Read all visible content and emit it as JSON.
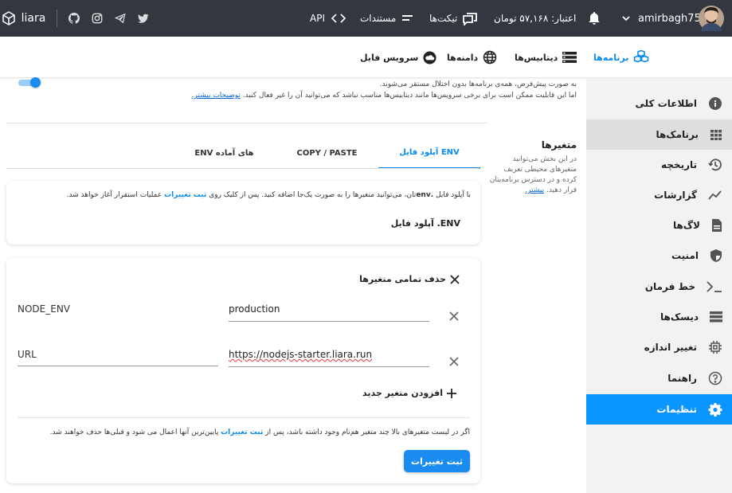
{
  "topbar": {
    "brand": "liara",
    "api": "API",
    "docs": "مستندات",
    "tickets": "تیکت‌ها",
    "credit": "اعتبار: ۵۷,۱۶۸ تومان",
    "username": "amirbagh75",
    "icons": [
      "cube-logo",
      "github",
      "instagram",
      "telegram",
      "twitter",
      "code",
      "docs-lines",
      "chat",
      "bell",
      "chevron-down",
      "avatar"
    ]
  },
  "secbar": {
    "apps": "برنامه‌ها",
    "databases": "دیتابیس‌ها",
    "domains": "دامنه‌ها",
    "file_service": "سرویس فایل"
  },
  "sidebar": {
    "items": [
      {
        "label": "اطلاعات کلی",
        "icon": "info-icon"
      },
      {
        "label": "برنامک‌ها",
        "icon": "grid-icon"
      },
      {
        "label": "تاریخچه",
        "icon": "history-icon"
      },
      {
        "label": "گزارشات",
        "icon": "chart-icon"
      },
      {
        "label": "لاگ‌ها",
        "icon": "document-icon"
      },
      {
        "label": "امنیت",
        "icon": "shield-icon"
      },
      {
        "label": "خط فرمان",
        "icon": "terminal-icon"
      },
      {
        "label": "دیسک‌ها",
        "icon": "disk-icon"
      },
      {
        "label": "تغییر اندازه",
        "icon": "chip-icon"
      },
      {
        "label": "راهنما",
        "icon": "help-icon"
      },
      {
        "label": "تنظیمات",
        "icon": "gear-icon"
      }
    ]
  },
  "network": {
    "line1": "به صورت پیش‌فرض، همه‌ی برنامه‌ها بدون اختلال مستقر می‌شوند.",
    "line2": "اما این قابلیت ممکن است برای برخی سرویس‌ها مانند دیتابیس‌ها مناسب نباشد که می‌توانید آن را غیر فعال کنید.",
    "more": "توضیحات بیشتر."
  },
  "vars_section": {
    "title": "متغیرها",
    "desc1": "در این بخش می‌توانید",
    "desc2": "متغیرهای محیطی تعریف",
    "desc3": "کرده و در دسترس برنامه‌یتان",
    "desc4": "قرار دهید.",
    "more": "بیشتر."
  },
  "tabs": [
    "آپلود فایل ENV",
    "COPY / PASTE",
    "ENV های آماده"
  ],
  "upload_card": {
    "text_pre": "با آپلود فایل",
    "text_env": ".env",
    "text_mid": "تان، می‌توانید متغیرها را به صورت یک‌جا اضافه کنید. پس از کلیک روی",
    "text_link": "ثبت تغییرات",
    "text_post": "عملیات استقرار آغاز خواهد شد.",
    "button": "آپلود فایل .ENV"
  },
  "env_card": {
    "delete_all": "حذف تمامی متغیرها",
    "vars": [
      {
        "key": "NODE_ENV",
        "value": "production"
      },
      {
        "key": "URL",
        "value": "https://nodejs-starter.liara.run"
      }
    ],
    "add_var": "افزودن متغیر جدید",
    "note_pre": "اگر در لیست متغیرهای بالا چند متغیر هم‌نام وجود داشته باشد، پس از",
    "note_link": "ثبت تغییرات",
    "note_post": "پایین‌ترین آنها اعمال می شود و قبلی‌ها حذف خواهند شد.",
    "save": "ثبت تغییرات"
  },
  "colors": {
    "accent": "#0a95ff",
    "topbar": "#333740",
    "sidebar": "#f2f2f2"
  }
}
